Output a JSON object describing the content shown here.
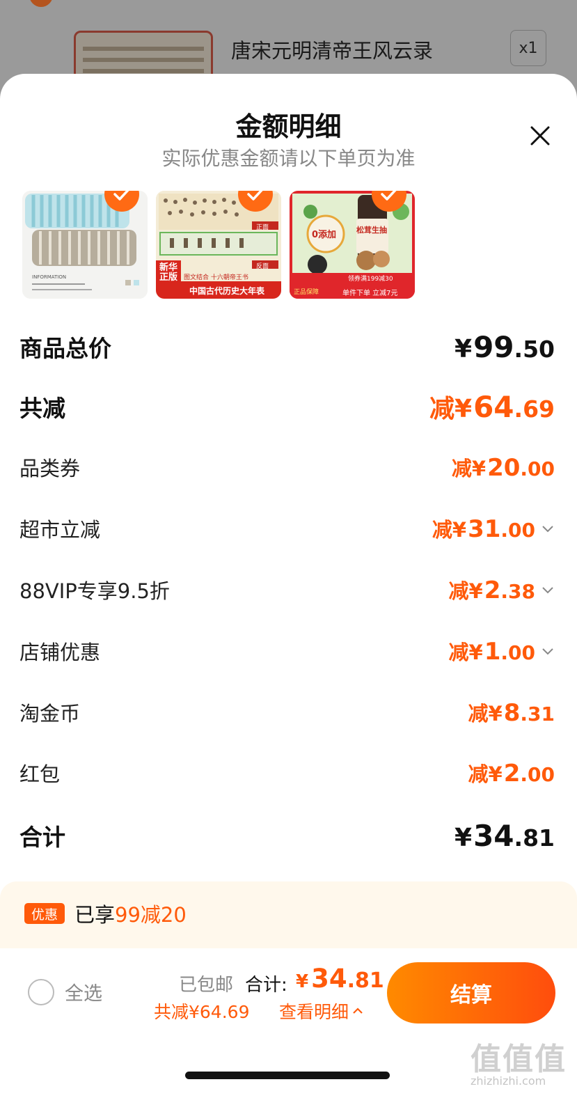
{
  "background_cart": {
    "product_title": "唐宋元明清帝王风云录",
    "quantity": "x1"
  },
  "sheet": {
    "title": "金额明细",
    "subtitle": "实际优惠金额请以下单页为准",
    "close_icon": "close-icon"
  },
  "thumbnails": {
    "t1": {
      "label": "INFORMATION"
    },
    "t2": {
      "badge": "新华\n正版",
      "top_tag": "图文结合 十六朝帝王书",
      "front": "正面",
      "back": "反面",
      "caption": "中国古代历史大年表"
    },
    "t3": {
      "badge": "0添加",
      "brand": "松茸生抽",
      "coupon": "领券满199减30",
      "guarantee": "正品保障",
      "offer": "单件下单 立减7元"
    }
  },
  "rows": {
    "goods_total": {
      "label": "商品总价",
      "prefix": "¥",
      "int": "99",
      "dec": ".50"
    },
    "total_discount": {
      "label": "共减",
      "prefix": "减¥",
      "int": "64",
      "dec": ".69"
    },
    "category_coupon": {
      "label": "品类券",
      "prefix": "减¥",
      "int": "20",
      "dec": ".00"
    },
    "supermarket": {
      "label": "超市立减",
      "prefix": "减¥",
      "int": "31",
      "dec": ".00"
    },
    "vip": {
      "label": "88VIP专享9.5折",
      "prefix": "减¥",
      "int": "2",
      "dec": ".38"
    },
    "store": {
      "label": "店铺优惠",
      "prefix": "减¥",
      "int": "1",
      "dec": ".00"
    },
    "coins": {
      "label": "淘金币",
      "prefix": "减¥",
      "int": "8",
      "dec": ".31"
    },
    "red_packet": {
      "label": "红包",
      "prefix": "减¥",
      "int": "2",
      "dec": ".00"
    },
    "sum": {
      "label": "合计",
      "prefix": "¥",
      "int": "34",
      "dec": ".81"
    }
  },
  "promo": {
    "badge": "优惠",
    "prefix": "已享",
    "highlight": "99减20"
  },
  "bottom": {
    "select_all": "全选",
    "shipping": "已包邮",
    "total_label": "合计:",
    "total_prefix": "¥",
    "total_int": "34",
    "total_dec": ".81",
    "saved": "共减¥64.69",
    "detail_link": "查看明细"
  },
  "watermark": {
    "logo": "值值值",
    "url": "zhizhizhi.com"
  },
  "colors": {
    "accent": "#ff5a0a",
    "checkout_gradient_start": "#ff8a00",
    "checkout_gradient_end": "#ff4d0d"
  }
}
